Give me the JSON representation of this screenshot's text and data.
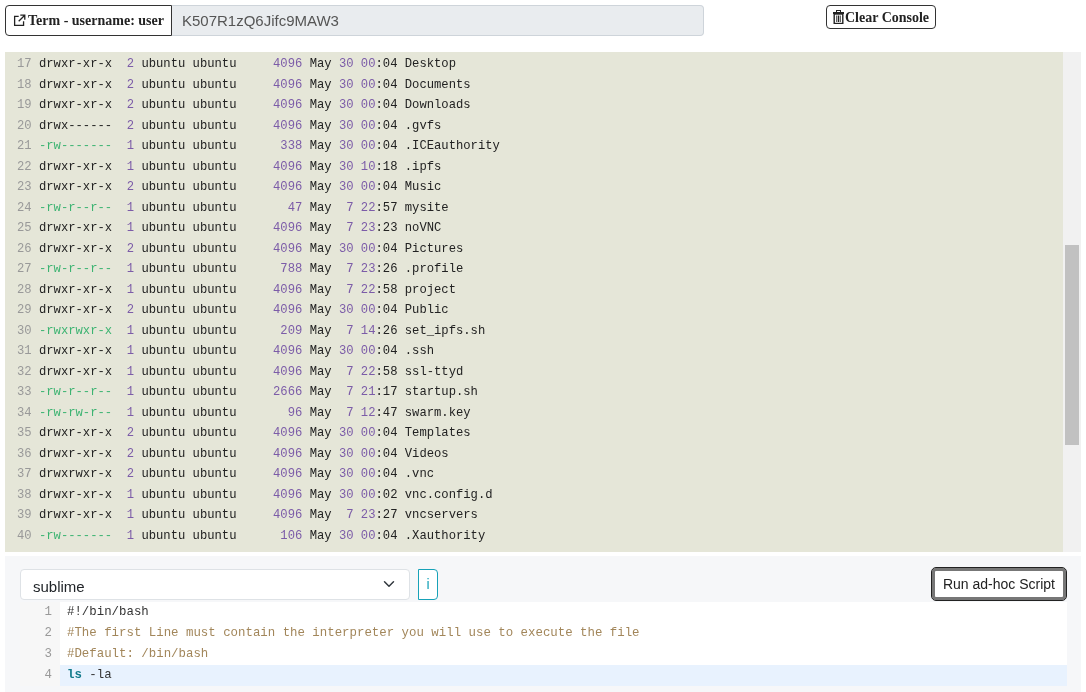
{
  "terminal_button": {
    "label": "Term - username: user"
  },
  "token_field": {
    "value": "K507R1zQ6Jifc9MAW3"
  },
  "clear_button": {
    "label": "Clear Console"
  },
  "console_lines": [
    {
      "num": "17",
      "perms": "drwxr-xr-x",
      "kind": "dir",
      "links": "2",
      "owner": "ubuntu",
      "group": "ubuntu",
      "size": "4096",
      "month": "May",
      "day": "30",
      "time": "00:04",
      "name": "Desktop"
    },
    {
      "num": "18",
      "perms": "drwxr-xr-x",
      "kind": "dir",
      "links": "2",
      "owner": "ubuntu",
      "group": "ubuntu",
      "size": "4096",
      "month": "May",
      "day": "30",
      "time": "00:04",
      "name": "Documents"
    },
    {
      "num": "19",
      "perms": "drwxr-xr-x",
      "kind": "dir",
      "links": "2",
      "owner": "ubuntu",
      "group": "ubuntu",
      "size": "4096",
      "month": "May",
      "day": "30",
      "time": "00:04",
      "name": "Downloads"
    },
    {
      "num": "20",
      "perms": "drwx------",
      "kind": "dir",
      "links": "2",
      "owner": "ubuntu",
      "group": "ubuntu",
      "size": "4096",
      "month": "May",
      "day": "30",
      "time": "00:04",
      "name": ".gvfs"
    },
    {
      "num": "21",
      "perms": "-rw-------",
      "kind": "file",
      "links": "1",
      "owner": "ubuntu",
      "group": "ubuntu",
      "size": "338",
      "month": "May",
      "day": "30",
      "time": "00:04",
      "name": ".ICEauthority"
    },
    {
      "num": "22",
      "perms": "drwxr-xr-x",
      "kind": "dir",
      "links": "1",
      "owner": "ubuntu",
      "group": "ubuntu",
      "size": "4096",
      "month": "May",
      "day": "30",
      "time": "10:18",
      "name": ".ipfs"
    },
    {
      "num": "23",
      "perms": "drwxr-xr-x",
      "kind": "dir",
      "links": "2",
      "owner": "ubuntu",
      "group": "ubuntu",
      "size": "4096",
      "month": "May",
      "day": "30",
      "time": "00:04",
      "name": "Music"
    },
    {
      "num": "24",
      "perms": "-rw-r--r--",
      "kind": "file",
      "links": "1",
      "owner": "ubuntu",
      "group": "ubuntu",
      "size": "47",
      "month": "May",
      "day": "7",
      "time": "22:57",
      "name": "mysite"
    },
    {
      "num": "25",
      "perms": "drwxr-xr-x",
      "kind": "dir",
      "links": "1",
      "owner": "ubuntu",
      "group": "ubuntu",
      "size": "4096",
      "month": "May",
      "day": "7",
      "time": "23:23",
      "name": "noVNC"
    },
    {
      "num": "26",
      "perms": "drwxr-xr-x",
      "kind": "dir",
      "links": "2",
      "owner": "ubuntu",
      "group": "ubuntu",
      "size": "4096",
      "month": "May",
      "day": "30",
      "time": "00:04",
      "name": "Pictures"
    },
    {
      "num": "27",
      "perms": "-rw-r--r--",
      "kind": "file",
      "links": "1",
      "owner": "ubuntu",
      "group": "ubuntu",
      "size": "788",
      "month": "May",
      "day": "7",
      "time": "23:26",
      "name": ".profile"
    },
    {
      "num": "28",
      "perms": "drwxr-xr-x",
      "kind": "dir",
      "links": "1",
      "owner": "ubuntu",
      "group": "ubuntu",
      "size": "4096",
      "month": "May",
      "day": "7",
      "time": "22:58",
      "name": "project"
    },
    {
      "num": "29",
      "perms": "drwxr-xr-x",
      "kind": "dir",
      "links": "2",
      "owner": "ubuntu",
      "group": "ubuntu",
      "size": "4096",
      "month": "May",
      "day": "30",
      "time": "00:04",
      "name": "Public"
    },
    {
      "num": "30",
      "perms": "-rwxrwxr-x",
      "kind": "file",
      "links": "1",
      "owner": "ubuntu",
      "group": "ubuntu",
      "size": "209",
      "month": "May",
      "day": "7",
      "time": "14:26",
      "name": "set_ipfs.sh"
    },
    {
      "num": "31",
      "perms": "drwxr-xr-x",
      "kind": "dir",
      "links": "1",
      "owner": "ubuntu",
      "group": "ubuntu",
      "size": "4096",
      "month": "May",
      "day": "30",
      "time": "00:04",
      "name": ".ssh"
    },
    {
      "num": "32",
      "perms": "drwxr-xr-x",
      "kind": "dir",
      "links": "1",
      "owner": "ubuntu",
      "group": "ubuntu",
      "size": "4096",
      "month": "May",
      "day": "7",
      "time": "22:58",
      "name": "ssl-ttyd"
    },
    {
      "num": "33",
      "perms": "-rw-r--r--",
      "kind": "file",
      "links": "1",
      "owner": "ubuntu",
      "group": "ubuntu",
      "size": "2666",
      "month": "May",
      "day": "7",
      "time": "21:17",
      "name": "startup.sh"
    },
    {
      "num": "34",
      "perms": "-rw-rw-r--",
      "kind": "file",
      "links": "1",
      "owner": "ubuntu",
      "group": "ubuntu",
      "size": "96",
      "month": "May",
      "day": "7",
      "time": "12:47",
      "name": "swarm.key"
    },
    {
      "num": "35",
      "perms": "drwxr-xr-x",
      "kind": "dir",
      "links": "2",
      "owner": "ubuntu",
      "group": "ubuntu",
      "size": "4096",
      "month": "May",
      "day": "30",
      "time": "00:04",
      "name": "Templates"
    },
    {
      "num": "36",
      "perms": "drwxr-xr-x",
      "kind": "dir",
      "links": "2",
      "owner": "ubuntu",
      "group": "ubuntu",
      "size": "4096",
      "month": "May",
      "day": "30",
      "time": "00:04",
      "name": "Videos"
    },
    {
      "num": "37",
      "perms": "drwxrwxr-x",
      "kind": "dir",
      "links": "2",
      "owner": "ubuntu",
      "group": "ubuntu",
      "size": "4096",
      "month": "May",
      "day": "30",
      "time": "00:04",
      "name": ".vnc"
    },
    {
      "num": "38",
      "perms": "drwxr-xr-x",
      "kind": "dir",
      "links": "1",
      "owner": "ubuntu",
      "group": "ubuntu",
      "size": "4096",
      "month": "May",
      "day": "30",
      "time": "00:02",
      "name": "vnc.config.d"
    },
    {
      "num": "39",
      "perms": "drwxr-xr-x",
      "kind": "dir",
      "links": "1",
      "owner": "ubuntu",
      "group": "ubuntu",
      "size": "4096",
      "month": "May",
      "day": "7",
      "time": "23:27",
      "name": "vncservers"
    },
    {
      "num": "40",
      "perms": "-rw-------",
      "kind": "file",
      "links": "1",
      "owner": "ubuntu",
      "group": "ubuntu",
      "size": "106",
      "month": "May",
      "day": "30",
      "time": "00:04",
      "name": ".Xauthority"
    }
  ],
  "theme_select": {
    "value": "sublime"
  },
  "info_button": {
    "label": "i"
  },
  "run_button": {
    "label": "Run ad-hoc Script"
  },
  "editor_lines": [
    {
      "num": "1",
      "kind": "shebang",
      "text": "#!/bin/bash",
      "active": false
    },
    {
      "num": "2",
      "kind": "comment",
      "text": "#The first Line must contain the interpreter you will use to execute the file",
      "active": false
    },
    {
      "num": "3",
      "kind": "comment",
      "text": "#Default: /bin/bash",
      "active": false
    },
    {
      "num": "4",
      "kind": "command",
      "text": "ls -la",
      "active": true
    }
  ]
}
